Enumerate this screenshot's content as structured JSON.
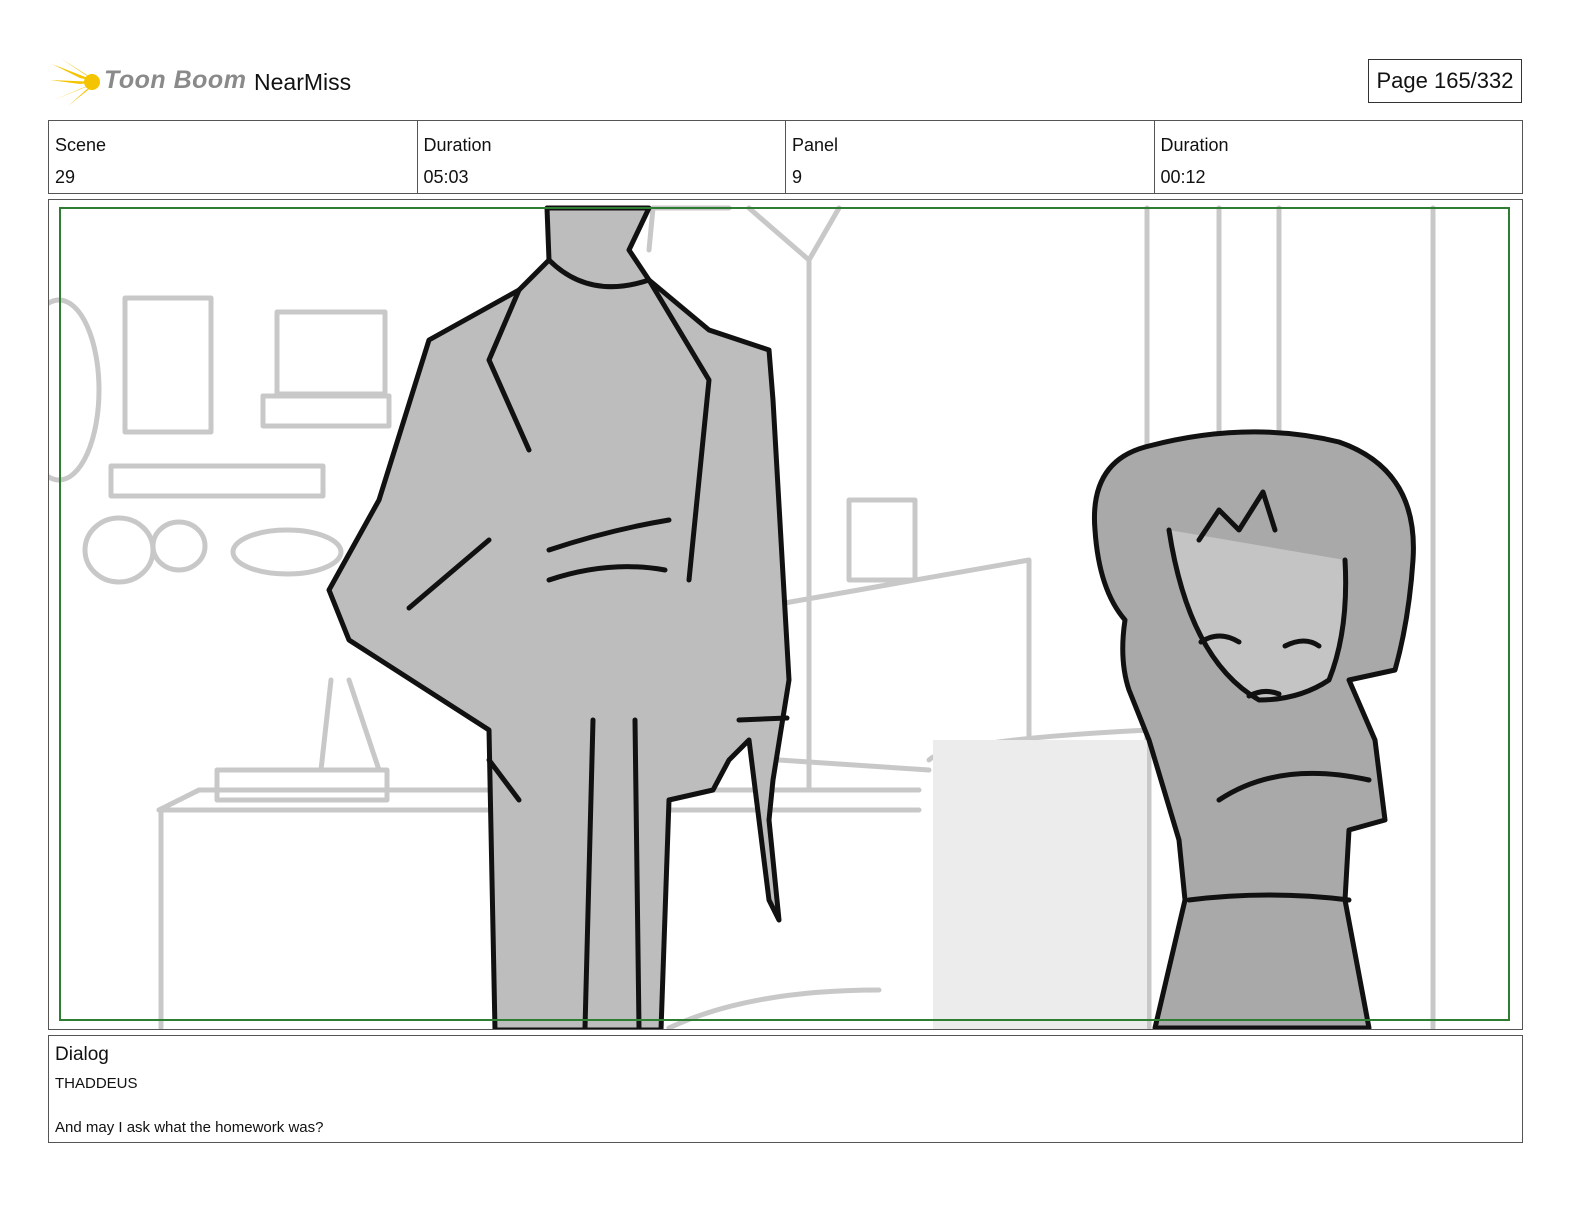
{
  "header": {
    "brand_name": "Toon Boom",
    "project_name": "NearMiss",
    "page_label": "Page 165/332"
  },
  "info": {
    "scene_label": "Scene",
    "scene_value": "29",
    "scene_duration_label": "Duration",
    "scene_duration_value": "05:03",
    "panel_label": "Panel",
    "panel_value": "9",
    "panel_duration_label": "Duration",
    "panel_duration_value": "00:12"
  },
  "dialog": {
    "title": "Dialog",
    "speaker": "THADDEUS",
    "line": "And may I ask what the homework was?"
  },
  "colors": {
    "safe_frame": "#2e7d32",
    "logo_star": "#f5c400",
    "sketch_grey": "#c8c8c8",
    "character_fill": "#bdbdbd"
  }
}
